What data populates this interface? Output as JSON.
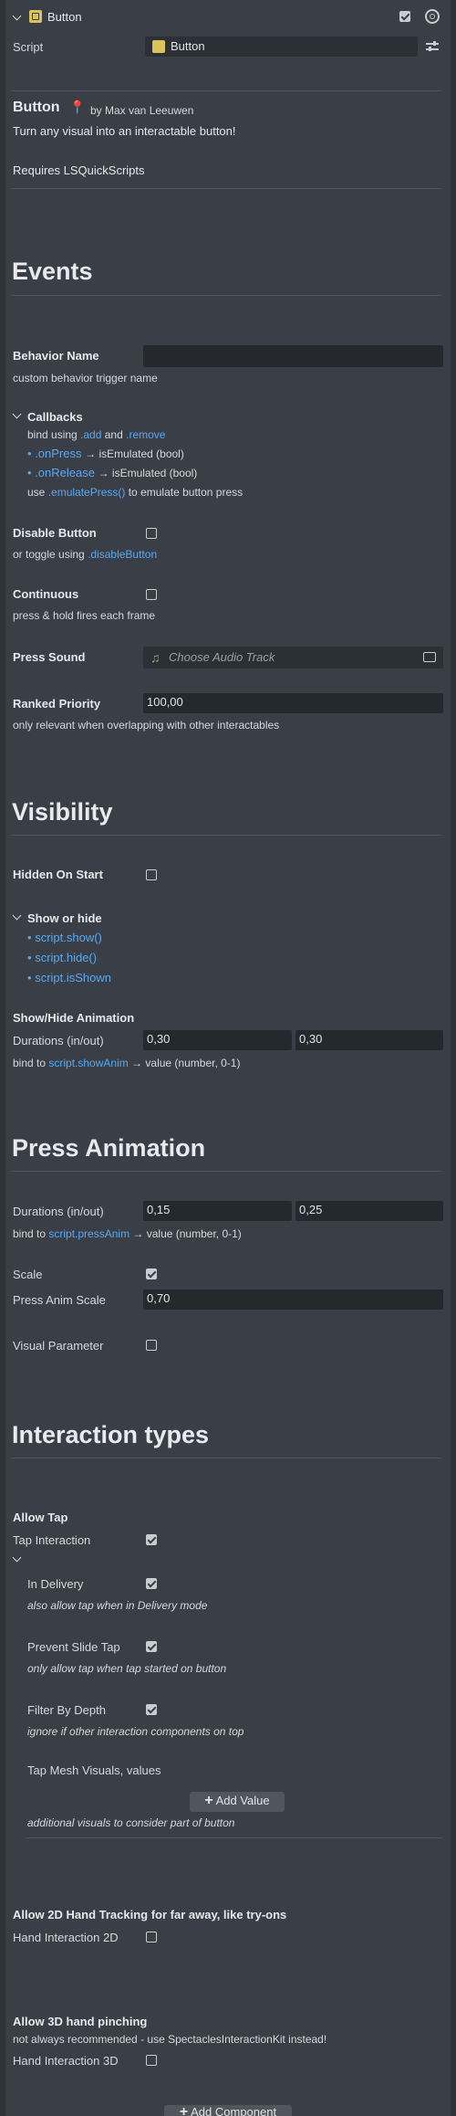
{
  "component": {
    "title": "Button",
    "script_label": "Script",
    "script_value": "Button"
  },
  "header": {
    "name": "Button",
    "pin": "📍",
    "author": "by Max van Leeuwen",
    "description": "Turn any visual into an interactable button!",
    "requires": "Requires LSQuickScripts"
  },
  "events": {
    "heading": "Events",
    "behavior_name_label": "Behavior Name",
    "behavior_name_value": "",
    "behavior_name_hint": "custom behavior trigger name",
    "callbacks_label": "Callbacks",
    "cb_line1_a": "bind using ",
    "cb_line1_b": ".add",
    "cb_line1_c": " and ",
    "cb_line1_d": ".remove",
    "cb_press": ".onPress",
    "cb_press_rest": "→ isEmulated (bool)",
    "cb_release": ".onRelease",
    "cb_release_rest": "→ isEmulated (bool)",
    "cb_use_a": "use ",
    "cb_use_b": ".emulatePress()",
    "cb_use_c": " to emulate button press",
    "disable_label": "Disable Button",
    "disable_hint_a": "or toggle using ",
    "disable_hint_b": ".disableButton",
    "continuous_label": "Continuous",
    "continuous_hint": "press & hold fires each frame",
    "press_sound_label": "Press Sound",
    "press_sound_placeholder": "Choose Audio Track",
    "ranked_label": "Ranked Priority",
    "ranked_value": "100,00",
    "ranked_hint": "only relevant when overlapping with other interactables"
  },
  "visibility": {
    "heading": "Visibility",
    "hidden_label": "Hidden On Start",
    "show_hide_label": "Show or hide",
    "items": [
      "script.show()",
      "script.hide()",
      "script.isShown"
    ],
    "anim_label": "Show/Hide Animation",
    "durations_label": "Durations (in/out)",
    "dur_in": "0,30",
    "dur_out": "0,30",
    "bind_a": "bind to ",
    "bind_b": "script.showAnim",
    "bind_c": " → value (number, 0-1)"
  },
  "press_anim": {
    "heading": "Press Animation",
    "durations_label": "Durations (in/out)",
    "dur_in": "0,15",
    "dur_out": "0,25",
    "bind_a": "bind to ",
    "bind_b": "script.pressAnim",
    "bind_c": " → value (number, 0-1)",
    "scale_label": "Scale",
    "press_scale_label": "Press Anim Scale",
    "press_scale_value": "0,70",
    "visual_param_label": "Visual Parameter"
  },
  "interaction": {
    "heading": "Interaction types",
    "allow_tap": "Allow Tap",
    "tap_interaction": "Tap Interaction",
    "in_delivery": "In Delivery",
    "in_delivery_hint": "also allow tap when in Delivery mode",
    "prevent_slide": "Prevent Slide Tap",
    "prevent_slide_hint": "only allow tap when tap started on button",
    "filter_depth": "Filter By Depth",
    "filter_depth_hint": "ignore if other interaction components on top",
    "tap_mesh": "Tap Mesh Visuals, values",
    "add_value": "Add Value",
    "tap_mesh_hint": "additional visuals to consider part of button",
    "allow_2d": "Allow 2D Hand Tracking for far away, like try-ons",
    "hand_2d": "Hand Interaction 2D",
    "allow_3d": "Allow 3D hand pinching",
    "allow_3d_hint": "not always recommended - use SpectaclesInteractionKit instead!",
    "hand_3d": "Hand Interaction 3D"
  },
  "footer": {
    "add_component": "Add Component"
  }
}
